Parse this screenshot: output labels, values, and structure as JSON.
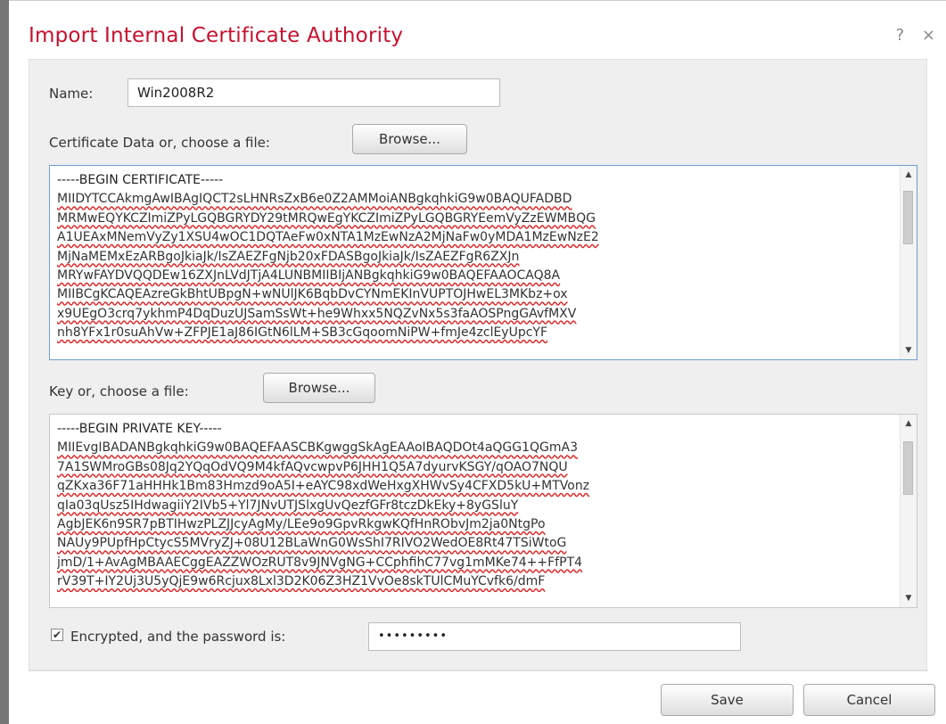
{
  "dialog": {
    "title": "Import Internal Certificate Authority",
    "help_label": "?",
    "close_label": "×"
  },
  "name_field": {
    "label": "Name:",
    "value": "Win2008R2"
  },
  "certificate": {
    "label": "Certificate Data or, choose a file:",
    "browse_label": "Browse...",
    "lines": [
      "-----BEGIN CERTIFICATE-----",
      "MIIDYTCCAkmgAwIBAgIQCT2sLHNRsZxB6e0Z2AMMoiANBgkqhkiG9w0BAQUFADBD",
      "MRMwEQYKCZImiZPyLGQBGRYDY29tMRQwEgYKCZImiZPyLGQBGRYEemVyZzEWMBQG",
      "A1UEAxMNemVyZy1XSU4wOC1DQTAeFw0xNTA1MzEwNzA2MjNaFw0yMDA1MzEwNzE2",
      "MjNaMEMxEzARBgoJkiaJk/IsZAEZFgNjb20xFDASBgoJkiaJk/IsZAEZFgR6ZXJn",
      "MRYwFAYDVQQDEw16ZXJnLVdJTjA4LUNBMIIBIjANBgkqhkiG9w0BAQEFAAOCAQ8A",
      "MIIBCgKCAQEAzreGkBhtUBpgN+wNUlJK6BqbDvCYNmEKInVUPTOJHwEL3MKbz+ox",
      "x9UEgO3crq7ykhmP4DqDuzUJSamSsWt+he9Whxx5NQZvNx5s3faAOSPngGAvfMXV",
      "nh8YFx1r0suAhVw+ZFPJE1aJ86IGtN6lLM+SB3cGqoomNiPW+fmJe4zclEyUpcYF"
    ]
  },
  "key": {
    "label": "Key or, choose a file:",
    "browse_label": "Browse...",
    "lines": [
      "-----BEGIN PRIVATE KEY-----",
      "MIIEvgIBADANBgkqhkiG9w0BAQEFAASCBKgwggSkAgEAAoIBAQDOt4aQGG1QGmA3",
      "7A1SWMroGBs08Jq2YQqOdVQ9M4kfAQvcwpvP6JHH1Q5A7dyurvKSGY/qOAO7NQU",
      "qZKxa36F71aHHHk1Bm83Hmzd9oA5I+eAYC98xdWeHxgXHWvSy4CFXD5kU+MTVonz",
      "qIa03qUsz5IHdwagiiY2IVb5+Yl7JNvUTJSlxgUvQezfGFr8tczDkEky+8yGSluY",
      "AgbJEK6n9SR7pBTIHwzPLZJJcyAgMy/LEe9o9GpvRkgwKQfHnRObvJm2ja0NtgPo",
      "NAUy9PUpfHpCtycS5MVryZJ+08U12BLaWnG0WsShI7RIVO2WedOE8Rt47TSiWtoG",
      "jmD/1+AvAgMBAAECggEAZZWOzRUT8v9JNVgNG+CCphfihC77vg1mMKe74++FfPT4",
      "rV39T+IY2Uj3U5yQjE9w6Rcjux8Lxl3D2K06Z3HZ1VvOe8skTUlCMuYCvfk6/dmF"
    ]
  },
  "encryption": {
    "checked_glyph": "✔",
    "label": "Encrypted, and the password is:",
    "password_mask": "•••••••••"
  },
  "buttons": {
    "save_label": "Save",
    "cancel_label": "Cancel"
  },
  "scrollbar": {
    "up_glyph": "▲",
    "down_glyph": "▼"
  }
}
